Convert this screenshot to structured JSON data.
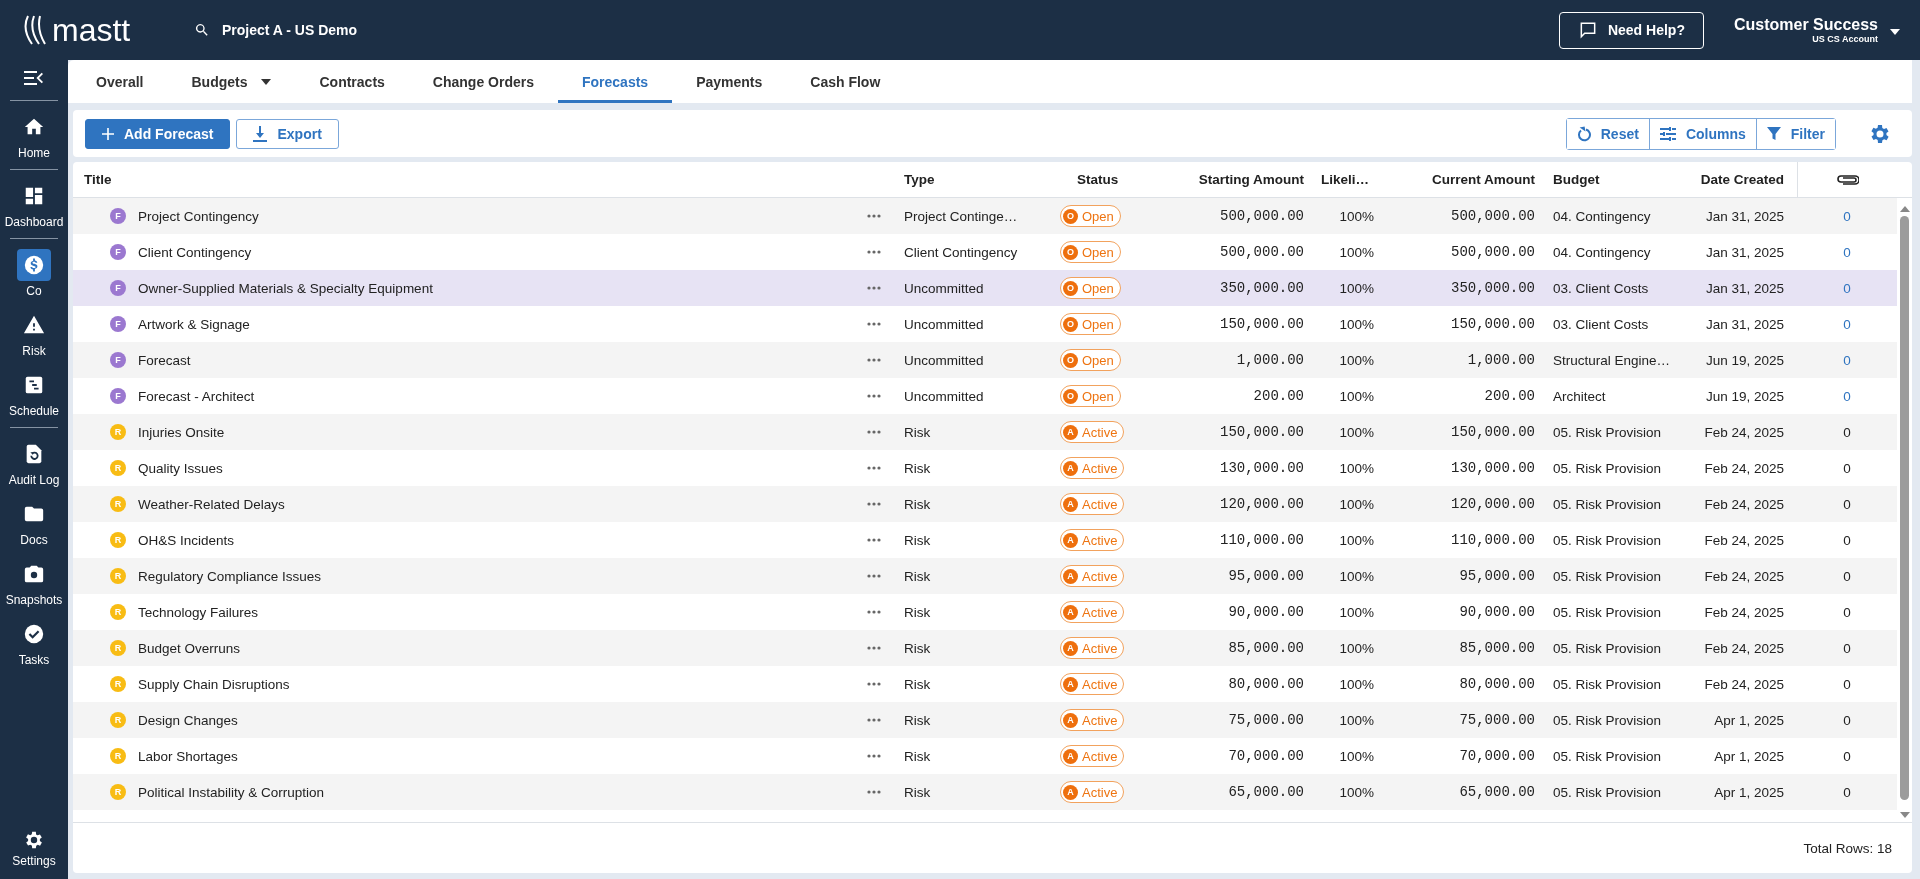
{
  "topbar": {
    "logo": "mastt",
    "project": "Project A - US Demo",
    "help_button": "Need Help?",
    "user_name": "Customer Success",
    "user_account": "US CS Account"
  },
  "sidebar": {
    "groups": [
      [
        {
          "label": "Home",
          "selected": false
        }
      ],
      [
        {
          "label": "Dashboard",
          "selected": false
        }
      ],
      [
        {
          "label": "Co",
          "selected": true
        },
        {
          "label": "Risk",
          "selected": false
        },
        {
          "label": "Schedule",
          "selected": false
        }
      ],
      [
        {
          "label": "Audit Log",
          "selected": false
        },
        {
          "label": "Docs",
          "selected": false
        },
        {
          "label": "Snapshots",
          "selected": false
        },
        {
          "label": "Tasks",
          "selected": false
        }
      ]
    ],
    "settings": "Settings"
  },
  "tabs": [
    {
      "label": "Overall",
      "selected": false,
      "dropdown": false
    },
    {
      "label": "Budgets",
      "selected": false,
      "dropdown": true
    },
    {
      "label": "Contracts",
      "selected": false,
      "dropdown": false
    },
    {
      "label": "Change Orders",
      "selected": false,
      "dropdown": false
    },
    {
      "label": "Forecasts",
      "selected": true,
      "dropdown": false
    },
    {
      "label": "Payments",
      "selected": false,
      "dropdown": false
    },
    {
      "label": "Cash Flow",
      "selected": false,
      "dropdown": false
    }
  ],
  "toolbar": {
    "add_button": "Add Forecast",
    "export_button": "Export",
    "reset_button": "Reset",
    "columns_button": "Columns",
    "filter_button": "Filter"
  },
  "table": {
    "columns": [
      "Title",
      "Type",
      "Status",
      "Starting Amount",
      "Likeli…",
      "Current Amount",
      "Budget",
      "Date Created"
    ],
    "rows": [
      {
        "kind": "forecast",
        "badge": "F",
        "title": "Project Contingency",
        "type": "Project Continge…",
        "status_letter": "O",
        "status": "Open",
        "starting": "500,000.00",
        "likelihood": "100%",
        "current": "500,000.00",
        "budget": "04. Contingency",
        "date": "Jan 31, 2025",
        "attachments": "0",
        "selected": false
      },
      {
        "kind": "forecast",
        "badge": "F",
        "title": "Client Contingency",
        "type": "Client Contingency",
        "status_letter": "O",
        "status": "Open",
        "starting": "500,000.00",
        "likelihood": "100%",
        "current": "500,000.00",
        "budget": "04. Contingency",
        "date": "Jan 31, 2025",
        "attachments": "0",
        "selected": false
      },
      {
        "kind": "forecast",
        "badge": "F",
        "title": "Owner-Supplied Materials & Specialty Equipment",
        "type": "Uncommitted",
        "status_letter": "O",
        "status": "Open",
        "starting": "350,000.00",
        "likelihood": "100%",
        "current": "350,000.00",
        "budget": "03. Client Costs",
        "date": "Jan 31, 2025",
        "attachments": "0",
        "selected": true
      },
      {
        "kind": "forecast",
        "badge": "F",
        "title": "Artwork & Signage",
        "type": "Uncommitted",
        "status_letter": "O",
        "status": "Open",
        "starting": "150,000.00",
        "likelihood": "100%",
        "current": "150,000.00",
        "budget": "03. Client Costs",
        "date": "Jan 31, 2025",
        "attachments": "0",
        "selected": false
      },
      {
        "kind": "forecast",
        "badge": "F",
        "title": "Forecast",
        "type": "Uncommitted",
        "status_letter": "O",
        "status": "Open",
        "starting": "1,000.00",
        "likelihood": "100%",
        "current": "1,000.00",
        "budget": "Structural Engine…",
        "date": "Jun 19, 2025",
        "attachments": "0",
        "selected": false
      },
      {
        "kind": "forecast",
        "badge": "F",
        "title": "Forecast - Architect",
        "type": "Uncommitted",
        "status_letter": "O",
        "status": "Open",
        "starting": "200.00",
        "likelihood": "100%",
        "current": "200.00",
        "budget": "Architect",
        "date": "Jun 19, 2025",
        "attachments": "0",
        "selected": false
      },
      {
        "kind": "risk",
        "badge": "R",
        "title": "Injuries Onsite",
        "type": "Risk",
        "status_letter": "A",
        "status": "Active",
        "starting": "150,000.00",
        "likelihood": "100%",
        "current": "150,000.00",
        "budget": "05. Risk Provision",
        "date": "Feb 24, 2025",
        "attachments": "0",
        "selected": false
      },
      {
        "kind": "risk",
        "badge": "R",
        "title": "Quality Issues",
        "type": "Risk",
        "status_letter": "A",
        "status": "Active",
        "starting": "130,000.00",
        "likelihood": "100%",
        "current": "130,000.00",
        "budget": "05. Risk Provision",
        "date": "Feb 24, 2025",
        "attachments": "0",
        "selected": false
      },
      {
        "kind": "risk",
        "badge": "R",
        "title": "Weather-Related Delays",
        "type": "Risk",
        "status_letter": "A",
        "status": "Active",
        "starting": "120,000.00",
        "likelihood": "100%",
        "current": "120,000.00",
        "budget": "05. Risk Provision",
        "date": "Feb 24, 2025",
        "attachments": "0",
        "selected": false
      },
      {
        "kind": "risk",
        "badge": "R",
        "title": "OH&S Incidents",
        "type": "Risk",
        "status_letter": "A",
        "status": "Active",
        "starting": "110,000.00",
        "likelihood": "100%",
        "current": "110,000.00",
        "budget": "05. Risk Provision",
        "date": "Feb 24, 2025",
        "attachments": "0",
        "selected": false
      },
      {
        "kind": "risk",
        "badge": "R",
        "title": "Regulatory Compliance Issues",
        "type": "Risk",
        "status_letter": "A",
        "status": "Active",
        "starting": "95,000.00",
        "likelihood": "100%",
        "current": "95,000.00",
        "budget": "05. Risk Provision",
        "date": "Feb 24, 2025",
        "attachments": "0",
        "selected": false
      },
      {
        "kind": "risk",
        "badge": "R",
        "title": "Technology Failures",
        "type": "Risk",
        "status_letter": "A",
        "status": "Active",
        "starting": "90,000.00",
        "likelihood": "100%",
        "current": "90,000.00",
        "budget": "05. Risk Provision",
        "date": "Feb 24, 2025",
        "attachments": "0",
        "selected": false
      },
      {
        "kind": "risk",
        "badge": "R",
        "title": "Budget Overruns",
        "type": "Risk",
        "status_letter": "A",
        "status": "Active",
        "starting": "85,000.00",
        "likelihood": "100%",
        "current": "85,000.00",
        "budget": "05. Risk Provision",
        "date": "Feb 24, 2025",
        "attachments": "0",
        "selected": false
      },
      {
        "kind": "risk",
        "badge": "R",
        "title": "Supply Chain Disruptions",
        "type": "Risk",
        "status_letter": "A",
        "status": "Active",
        "starting": "80,000.00",
        "likelihood": "100%",
        "current": "80,000.00",
        "budget": "05. Risk Provision",
        "date": "Feb 24, 2025",
        "attachments": "0",
        "selected": false
      },
      {
        "kind": "risk",
        "badge": "R",
        "title": "Design Changes",
        "type": "Risk",
        "status_letter": "A",
        "status": "Active",
        "starting": "75,000.00",
        "likelihood": "100%",
        "current": "75,000.00",
        "budget": "05. Risk Provision",
        "date": "Apr 1, 2025",
        "attachments": "0",
        "selected": false
      },
      {
        "kind": "risk",
        "badge": "R",
        "title": "Labor Shortages",
        "type": "Risk",
        "status_letter": "A",
        "status": "Active",
        "starting": "70,000.00",
        "likelihood": "100%",
        "current": "70,000.00",
        "budget": "05. Risk Provision",
        "date": "Apr 1, 2025",
        "attachments": "0",
        "selected": false
      },
      {
        "kind": "risk",
        "badge": "R",
        "title": "Political Instability & Corruption",
        "type": "Risk",
        "status_letter": "A",
        "status": "Active",
        "starting": "65,000.00",
        "likelihood": "100%",
        "current": "65,000.00",
        "budget": "05. Risk Provision",
        "date": "Apr 1, 2025",
        "attachments": "0",
        "selected": false
      }
    ],
    "total_rows": "Total Rows: 18"
  }
}
